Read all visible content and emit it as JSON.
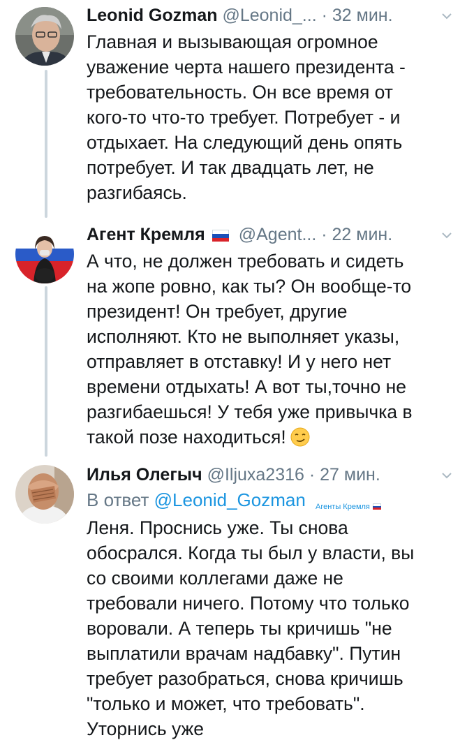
{
  "tweets": [
    {
      "name": "Leonid Gozman",
      "handle": "@Leonid_...",
      "separator": "·",
      "time": "32 мин.",
      "avatar_icon": "person-photo-avatar",
      "text": "Главная и вызывающая огромное\nуважение черта нашего президента -\nтребовательность. Он все время от\nкого-то что-то требует. Потребует - и\nотдыхает. На следующий день опять\nпотребует. И так двадцать лет, не\nразгибаясь."
    },
    {
      "name": "Агент Кремля",
      "flag_icon": "russian-flag-icon",
      "handle": "@Agent...",
      "separator": "·",
      "time": "22 мин.",
      "avatar_icon": "woman-with-flag-avatar",
      "text": "А что, не должен требовать и сидеть\nна жопе ровно, как ты? Он вообще-то\nпрезидент! Он требует, другие\nисполняют. Кто не выполняет указы,\nотправляет в отставку! И у него нет\nвремени отдыхать! А вот ты,точно не\nразгибаешься! У тебя уже привычка в\nтакой позе находиться!",
      "emoji": "smirking-face-emoji"
    },
    {
      "name": "Илья Олегыч",
      "handle": "@Iljuxa2316",
      "separator": "·",
      "time": "27 мин.",
      "avatar_icon": "facepalm-man-avatar",
      "reply_prefix": "В ответ",
      "reply_handle": "@Leonid_Gozman",
      "watermark": "Агенты Кремля",
      "text": "Леня. Проснись уже. Ты снова\nобосрался. Когда ты был у власти, вы\nсо своими коллегами даже не\nтребовали ничего. Потому что только\nворовали. А теперь ты кричишь \"не\nвыплатили врачам надбавку\". Путин\nтребует разобраться, снова кричишь\n\"только и может, что требовать\".\nУторнись уже"
    }
  ],
  "colors": {
    "text": "#14171a",
    "secondary": "#657786",
    "link": "#1b95e0",
    "thread_line": "#ccd6dd"
  }
}
